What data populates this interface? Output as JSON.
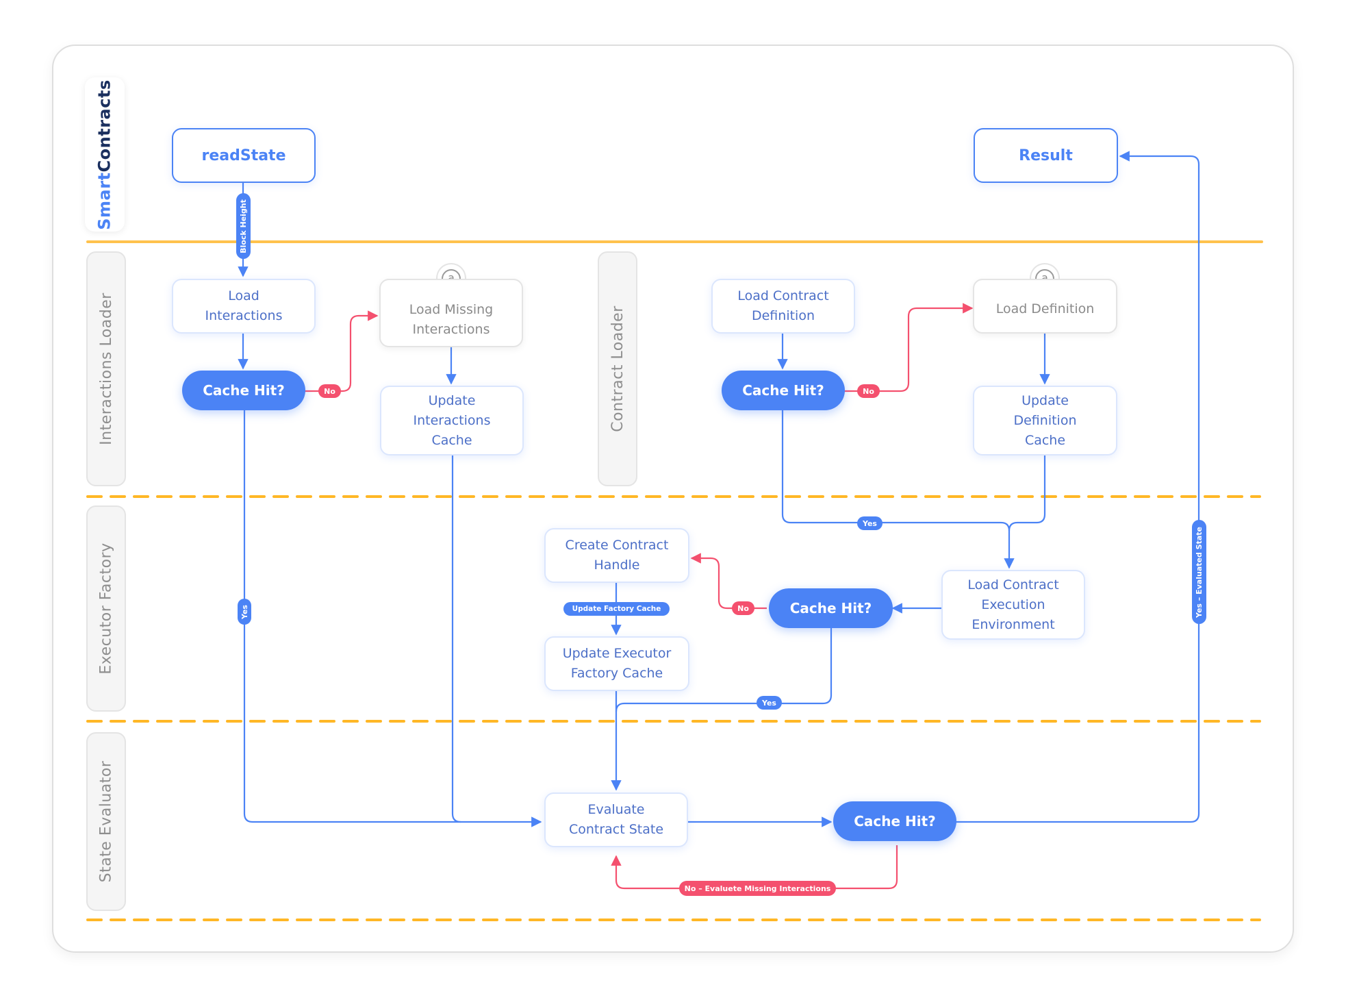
{
  "brand": {
    "part1": "Smart",
    "part2": "Contracts"
  },
  "colors": {
    "accent": "#4b83f5",
    "negative": "#f4506e",
    "lane_divider": "#ffc24d",
    "brand_dark": "#1a2f5e"
  },
  "lanes": [
    {
      "id": "interactions-loader",
      "label": "Interactions Loader"
    },
    {
      "id": "contract-loader",
      "label": "Contract Loader"
    },
    {
      "id": "executor-factory",
      "label": "Executor Factory"
    },
    {
      "id": "state-evaluator",
      "label": "State Evaluator"
    }
  ],
  "nodes": {
    "read_state": "readState",
    "result": "Result",
    "load_interactions": "Load\nInteractions",
    "il_cache_hit": "Cache Hit?",
    "load_missing_interactions": "Load Missing\nInteractions",
    "update_interactions_cache": "Update\nInteractions\nCache",
    "load_contract_definition": "Load Contract\nDefinition",
    "cl_cache_hit": "Cache Hit?",
    "load_definition": "Load Definition",
    "update_definition_cache": "Update\nDefinition\nCache",
    "create_contract_handle": "Create Contract\nHandle",
    "update_executor_factory_cache": "Update Executor\nFactory Cache",
    "ef_cache_hit": "Cache Hit?",
    "load_contract_execution_environment": "Load Contract\nExecution\nEnvironment",
    "evaluate_contract_state": "Evaluate\nContract State",
    "se_cache_hit": "Cache Hit?"
  },
  "external_badge": "a",
  "edge_labels": {
    "block_height": "Block Height",
    "il_no": "No",
    "il_yes": "Yes",
    "cl_no": "No",
    "cl_yes": "Yes",
    "ef_no": "No",
    "ef_yes": "Yes",
    "update_factory_cache": "Update Factory Cache",
    "se_no": "No – Evaluete Missing Interactions",
    "se_yes": "Yes – Evaluated State"
  }
}
